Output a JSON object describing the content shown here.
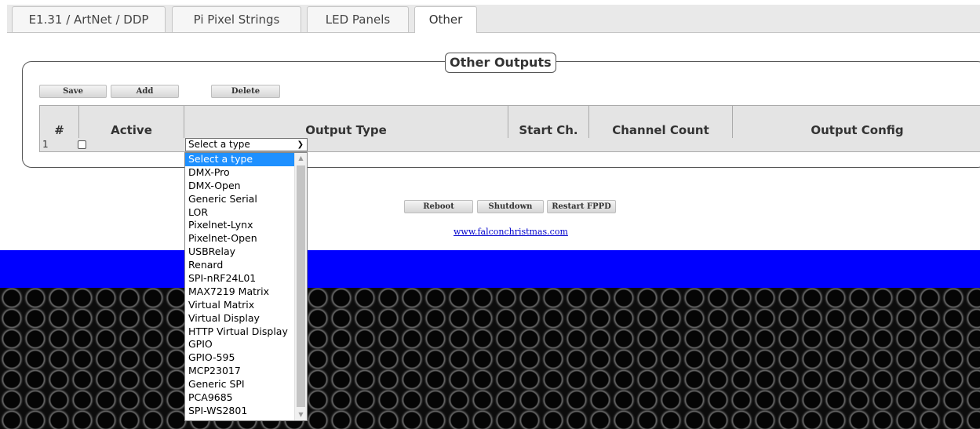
{
  "tabs": [
    "E1.31 / ArtNet / DDP",
    "Pi Pixel Strings",
    "LED Panels",
    "Other"
  ],
  "active_tab": "Other",
  "section_title": "Other Outputs",
  "toolbar": {
    "save": "Save",
    "add": "Add",
    "delete": "Delete"
  },
  "table": {
    "headers": [
      "#",
      "Active",
      "Output Type",
      "Start Ch.",
      "Channel Count",
      "Output Config"
    ],
    "rows": [
      {
        "num": "1",
        "active": false,
        "output_type": "Select a type"
      }
    ]
  },
  "output_type_options": [
    "Select a type",
    "DMX-Pro",
    "DMX-Open",
    "Generic Serial",
    "LOR",
    "Pixelnet-Lynx",
    "Pixelnet-Open",
    "USBRelay",
    "Renard",
    "SPI-nRF24L01",
    "MAX7219 Matrix",
    "Virtual Matrix",
    "Virtual Display",
    "HTTP Virtual Display",
    "GPIO",
    "GPIO-595",
    "MCP23017",
    "Generic SPI",
    "PCA9685",
    "SPI-WS2801"
  ],
  "selected_option": "Select a type",
  "footer": {
    "reboot": "Reboot",
    "shutdown": "Shutdown",
    "restart": "Restart FPPD",
    "link": "www.falconchristmas.com"
  },
  "colors": {
    "blue_bar": "#0000ff",
    "selected_option_bg": "#1e90ff"
  }
}
